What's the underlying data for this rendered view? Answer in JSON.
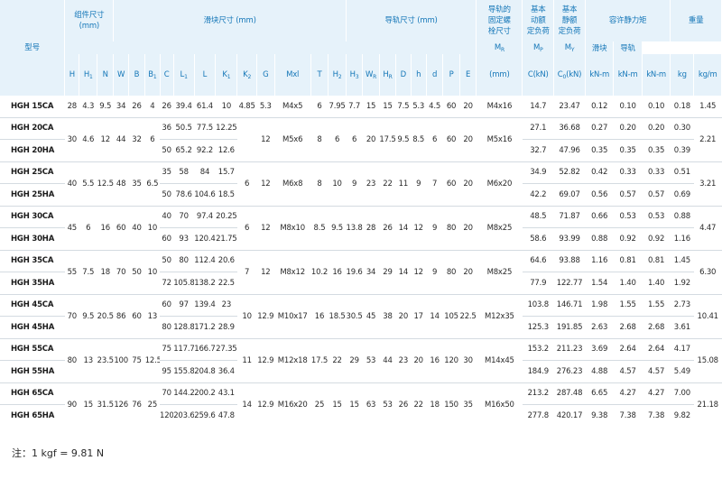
{
  "headers": {
    "model": "型号",
    "assembly_dims_1": "组件尺寸",
    "assembly_dims_unit": "(mm)",
    "block_dims": "滑块尺寸 (mm)",
    "rail_dims": "导轨尺寸 (mm)",
    "rail_bolt_1": "导轨的",
    "rail_bolt_2": "固定螺",
    "rail_bolt_3": "栓尺寸",
    "dyn_load_1": "基本",
    "dyn_load_2": "动额",
    "dyn_load_3": "定负荷",
    "static_load_1": "基本",
    "static_load_2": "静额",
    "static_load_3": "定负荷",
    "static_moment": "容许静力矩",
    "weight": "重量",
    "block_weight": "滑块",
    "rail_weight": "导轨",
    "mm": "(mm)",
    "knm": "kN-m",
    "kg": "kg",
    "kgm": "kg/m"
  },
  "groups": [
    {
      "H": "28",
      "H1": "4.3",
      "N": "9.5",
      "W": "34",
      "B": "26",
      "B1": "4",
      "K2": "4.85",
      "G": "5.3",
      "Mxl": "M4x5",
      "T": "6",
      "H2": "7.95",
      "H3": "7.7",
      "WR": "15",
      "HR": "15",
      "D": "7.5",
      "h": "5.3",
      "d": "4.5",
      "P": "60",
      "E": "20",
      "bolt": "M4x16",
      "rail_kg": "1.45",
      "rows": [
        {
          "model": "HGH 15CA",
          "C": "26",
          "L1": "39.4",
          "L": "61.4",
          "K1": "10",
          "Ckn": "14.7",
          "C0kn": "23.47",
          "MR": "0.12",
          "MP": "0.10",
          "MY": "0.10",
          "kg": "0.18"
        }
      ]
    },
    {
      "H": "30",
      "H1": "4.6",
      "N": "12",
      "W": "44",
      "B": "32",
      "B1": "6",
      "K2": "",
      "G": "12",
      "Mxl": "M5x6",
      "T": "8",
      "H2": "6",
      "H3": "6",
      "WR": "20",
      "HR": "17.5",
      "D": "9.5",
      "h": "8.5",
      "d": "6",
      "P": "60",
      "E": "20",
      "bolt": "M5x16",
      "rail_kg": "2.21",
      "rows": [
        {
          "model": "HGH 20CA",
          "C": "36",
          "L1": "50.5",
          "L": "77.5",
          "K1": "12.25",
          "Ckn": "27.1",
          "C0kn": "36.68",
          "MR": "0.27",
          "MP": "0.20",
          "MY": "0.20",
          "kg": "0.30"
        },
        {
          "model": "HGH 20HA",
          "C": "50",
          "L1": "65.2",
          "L": "92.2",
          "K1": "12.6",
          "Ckn": "32.7",
          "C0kn": "47.96",
          "MR": "0.35",
          "MP": "0.35",
          "MY": "0.35",
          "kg": "0.39"
        }
      ]
    },
    {
      "H": "40",
      "H1": "5.5",
      "N": "12.5",
      "W": "48",
      "B": "35",
      "B1": "6.5",
      "K2": "6",
      "G": "12",
      "Mxl": "M6x8",
      "T": "8",
      "H2": "10",
      "H3": "9",
      "WR": "23",
      "HR": "22",
      "D": "11",
      "h": "9",
      "d": "7",
      "P": "60",
      "E": "20",
      "bolt": "M6x20",
      "rail_kg": "3.21",
      "rows": [
        {
          "model": "HGH 25CA",
          "C": "35",
          "L1": "58",
          "L": "84",
          "K1": "15.7",
          "Ckn": "34.9",
          "C0kn": "52.82",
          "MR": "0.42",
          "MP": "0.33",
          "MY": "0.33",
          "kg": "0.51"
        },
        {
          "model": "HGH 25HA",
          "C": "50",
          "L1": "78.6",
          "L": "104.6",
          "K1": "18.5",
          "Ckn": "42.2",
          "C0kn": "69.07",
          "MR": "0.56",
          "MP": "0.57",
          "MY": "0.57",
          "kg": "0.69"
        }
      ]
    },
    {
      "H": "45",
      "H1": "6",
      "N": "16",
      "W": "60",
      "B": "40",
      "B1": "10",
      "K2": "6",
      "G": "12",
      "Mxl": "M8x10",
      "T": "8.5",
      "H2": "9.5",
      "H3": "13.8",
      "WR": "28",
      "HR": "26",
      "D": "14",
      "h": "12",
      "d": "9",
      "P": "80",
      "E": "20",
      "bolt": "M8x25",
      "rail_kg": "4.47",
      "rows": [
        {
          "model": "HGH 30CA",
          "C": "40",
          "L1": "70",
          "L": "97.4",
          "K1": "20.25",
          "Ckn": "48.5",
          "C0kn": "71.87",
          "MR": "0.66",
          "MP": "0.53",
          "MY": "0.53",
          "kg": "0.88"
        },
        {
          "model": "HGH 30HA",
          "C": "60",
          "L1": "93",
          "L": "120.4",
          "K1": "21.75",
          "Ckn": "58.6",
          "C0kn": "93.99",
          "MR": "0.88",
          "MP": "0.92",
          "MY": "0.92",
          "kg": "1.16"
        }
      ]
    },
    {
      "H": "55",
      "H1": "7.5",
      "N": "18",
      "W": "70",
      "B": "50",
      "B1": "10",
      "K2": "7",
      "G": "12",
      "Mxl": "M8x12",
      "T": "10.2",
      "H2": "16",
      "H3": "19.6",
      "WR": "34",
      "HR": "29",
      "D": "14",
      "h": "12",
      "d": "9",
      "P": "80",
      "E": "20",
      "bolt": "M8x25",
      "rail_kg": "6.30",
      "rows": [
        {
          "model": "HGH 35CA",
          "C": "50",
          "L1": "80",
          "L": "112.4",
          "K1": "20.6",
          "Ckn": "64.6",
          "C0kn": "93.88",
          "MR": "1.16",
          "MP": "0.81",
          "MY": "0.81",
          "kg": "1.45"
        },
        {
          "model": "HGH 35HA",
          "C": "72",
          "L1": "105.8",
          "L": "138.2",
          "K1": "22.5",
          "Ckn": "77.9",
          "C0kn": "122.77",
          "MR": "1.54",
          "MP": "1.40",
          "MY": "1.40",
          "kg": "1.92"
        }
      ]
    },
    {
      "H": "70",
      "H1": "9.5",
      "N": "20.5",
      "W": "86",
      "B": "60",
      "B1": "13",
      "K2": "10",
      "G": "12.9",
      "Mxl": "M10x17",
      "T": "16",
      "H2": "18.5",
      "H3": "30.5",
      "WR": "45",
      "HR": "38",
      "D": "20",
      "h": "17",
      "d": "14",
      "P": "105",
      "E": "22.5",
      "bolt": "M12x35",
      "rail_kg": "10.41",
      "rows": [
        {
          "model": "HGH 45CA",
          "C": "60",
          "L1": "97",
          "L": "139.4",
          "K1": "23",
          "Ckn": "103.8",
          "C0kn": "146.71",
          "MR": "1.98",
          "MP": "1.55",
          "MY": "1.55",
          "kg": "2.73"
        },
        {
          "model": "HGH 45HA",
          "C": "80",
          "L1": "128.8",
          "L": "171.2",
          "K1": "28.9",
          "Ckn": "125.3",
          "C0kn": "191.85",
          "MR": "2.63",
          "MP": "2.68",
          "MY": "2.68",
          "kg": "3.61"
        }
      ]
    },
    {
      "H": "80",
      "H1": "13",
      "N": "23.5",
      "W": "100",
      "B": "75",
      "B1": "12.5",
      "K2": "11",
      "G": "12.9",
      "Mxl": "M12x18",
      "T": "17.5",
      "H2": "22",
      "H3": "29",
      "WR": "53",
      "HR": "44",
      "D": "23",
      "h": "20",
      "d": "16",
      "P": "120",
      "E": "30",
      "bolt": "M14x45",
      "rail_kg": "15.08",
      "rows": [
        {
          "model": "HGH 55CA",
          "C": "75",
          "L1": "117.7",
          "L": "166.7",
          "K1": "27.35",
          "Ckn": "153.2",
          "C0kn": "211.23",
          "MR": "3.69",
          "MP": "2.64",
          "MY": "2.64",
          "kg": "4.17"
        },
        {
          "model": "HGH 55HA",
          "C": "95",
          "L1": "155.8",
          "L": "204.8",
          "K1": "36.4",
          "Ckn": "184.9",
          "C0kn": "276.23",
          "MR": "4.88",
          "MP": "4.57",
          "MY": "4.57",
          "kg": "5.49"
        }
      ]
    },
    {
      "H": "90",
      "H1": "15",
      "N": "31.5",
      "W": "126",
      "B": "76",
      "B1": "25",
      "K2": "14",
      "G": "12.9",
      "Mxl": "M16x20",
      "T": "25",
      "H2": "15",
      "H3": "15",
      "WR": "63",
      "HR": "53",
      "D": "26",
      "h": "22",
      "d": "18",
      "P": "150",
      "E": "35",
      "bolt": "M16x50",
      "rail_kg": "21.18",
      "rows": [
        {
          "model": "HGH 65CA",
          "C": "70",
          "L1": "144.2",
          "L": "200.2",
          "K1": "43.1",
          "Ckn": "213.2",
          "C0kn": "287.48",
          "MR": "6.65",
          "MP": "4.27",
          "MY": "4.27",
          "kg": "7.00"
        },
        {
          "model": "HGH 65HA",
          "C": "120",
          "L1": "203.6",
          "L": "259.6",
          "K1": "47.8",
          "Ckn": "277.8",
          "C0kn": "420.17",
          "MR": "9.38",
          "MP": "7.38",
          "MY": "7.38",
          "kg": "9.82"
        }
      ]
    }
  ],
  "note": "注：1 kgf = 9.81 N"
}
